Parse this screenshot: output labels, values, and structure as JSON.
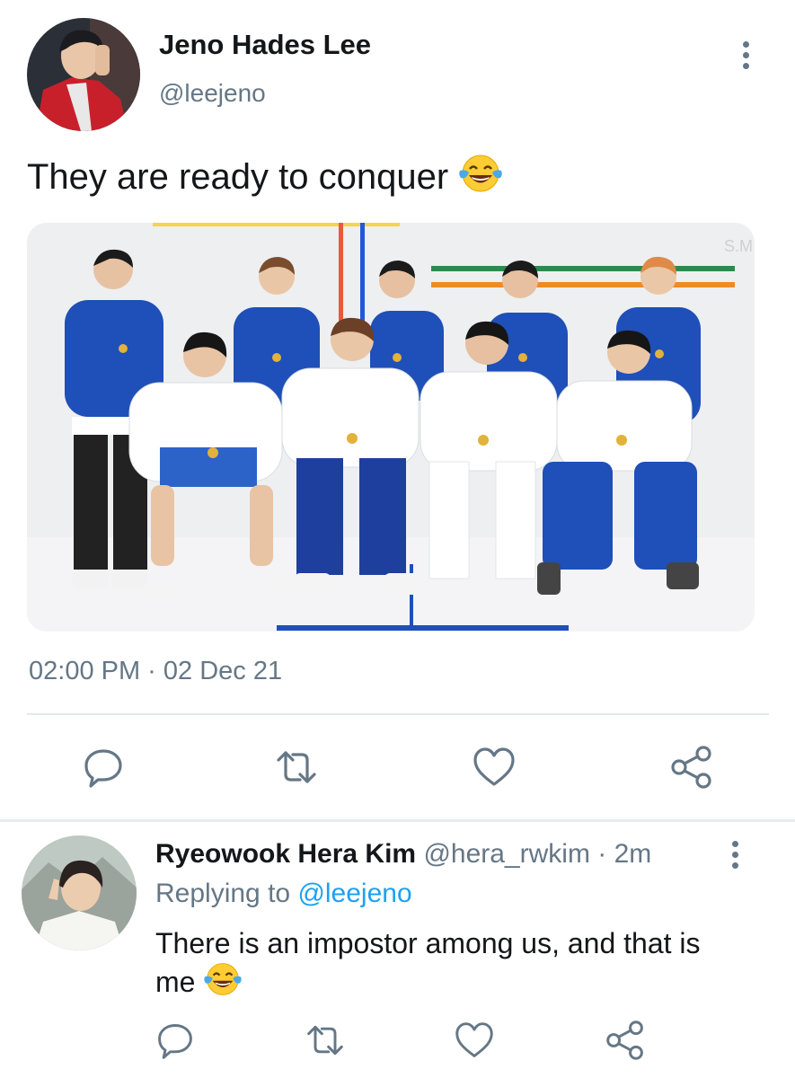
{
  "tweet": {
    "author_name": "Jeno Hades Lee",
    "author_handle": "@leejeno",
    "text": "They are ready to conquer",
    "emoji": "face-with-tears-of-joy",
    "photo_watermark": "S.M",
    "timestamp": "02:00 PM · 02 Dec 21"
  },
  "reply": {
    "author_name": "Ryeowook Hera Kim",
    "author_handle": "@hera_rwkim",
    "time_ago": "· 2m",
    "replying_prefix": "Replying to",
    "replying_handle": "@leejeno",
    "text_line1": "There is an impostor among us, and that is",
    "text_line2": "me",
    "emoji": "face-with-tears-of-joy"
  },
  "actions": [
    "reply-icon",
    "retweet-icon",
    "like-icon",
    "share-icon"
  ],
  "colors": {
    "text": "#14171a",
    "muted": "#657786",
    "link": "#1da1f2",
    "divider": "#e1e8ed",
    "jacket_blue": "#1f4fb8"
  }
}
